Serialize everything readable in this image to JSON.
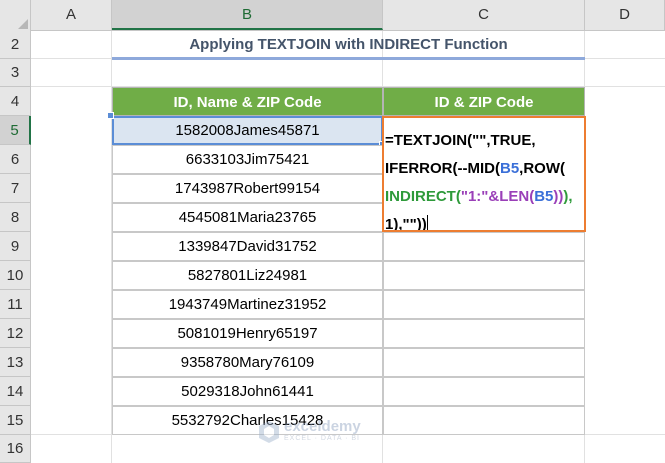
{
  "columns": [
    "A",
    "B",
    "C",
    "D"
  ],
  "rows": [
    "2",
    "3",
    "4",
    "5",
    "6",
    "7",
    "8",
    "9",
    "10",
    "11",
    "12",
    "13",
    "14",
    "15",
    "16"
  ],
  "active_row": "5",
  "title": "Applying TEXTJOIN with INDIRECT Function",
  "headers": {
    "b": "ID, Name & ZIP Code",
    "c": "ID & ZIP Code"
  },
  "data": [
    "1582008James45871",
    "6633103Jim75421",
    "1743987Robert99154",
    "4545081Maria23765",
    "1339847David31752",
    "5827801Liz24981",
    "1943749Martinez31952",
    "5081019Henry65197",
    "9358780Mary76109",
    "5029318John61441",
    "5532792Charles15428"
  ],
  "formula": {
    "line1": {
      "a": "=TEXTJOIN(\"\",TRUE,"
    },
    "line2": {
      "a": "IFERROR(--MID(",
      "b": "B5",
      "c": ",ROW("
    },
    "line3": {
      "a": "INDIRECT(",
      "b": "\"1:\"&LEN(",
      "c": "B5",
      "d": "))",
      "e": "),"
    },
    "line4": {
      "a": "1),\"\"))"
    }
  },
  "watermark": {
    "name": "exceldemy",
    "tagline": "EXCEL · DATA · BI"
  },
  "colors": {
    "header_green": "#70ad47",
    "formula_border": "#ed7d31",
    "title_text": "#44546a",
    "active_cell": "#dbe5f1"
  }
}
